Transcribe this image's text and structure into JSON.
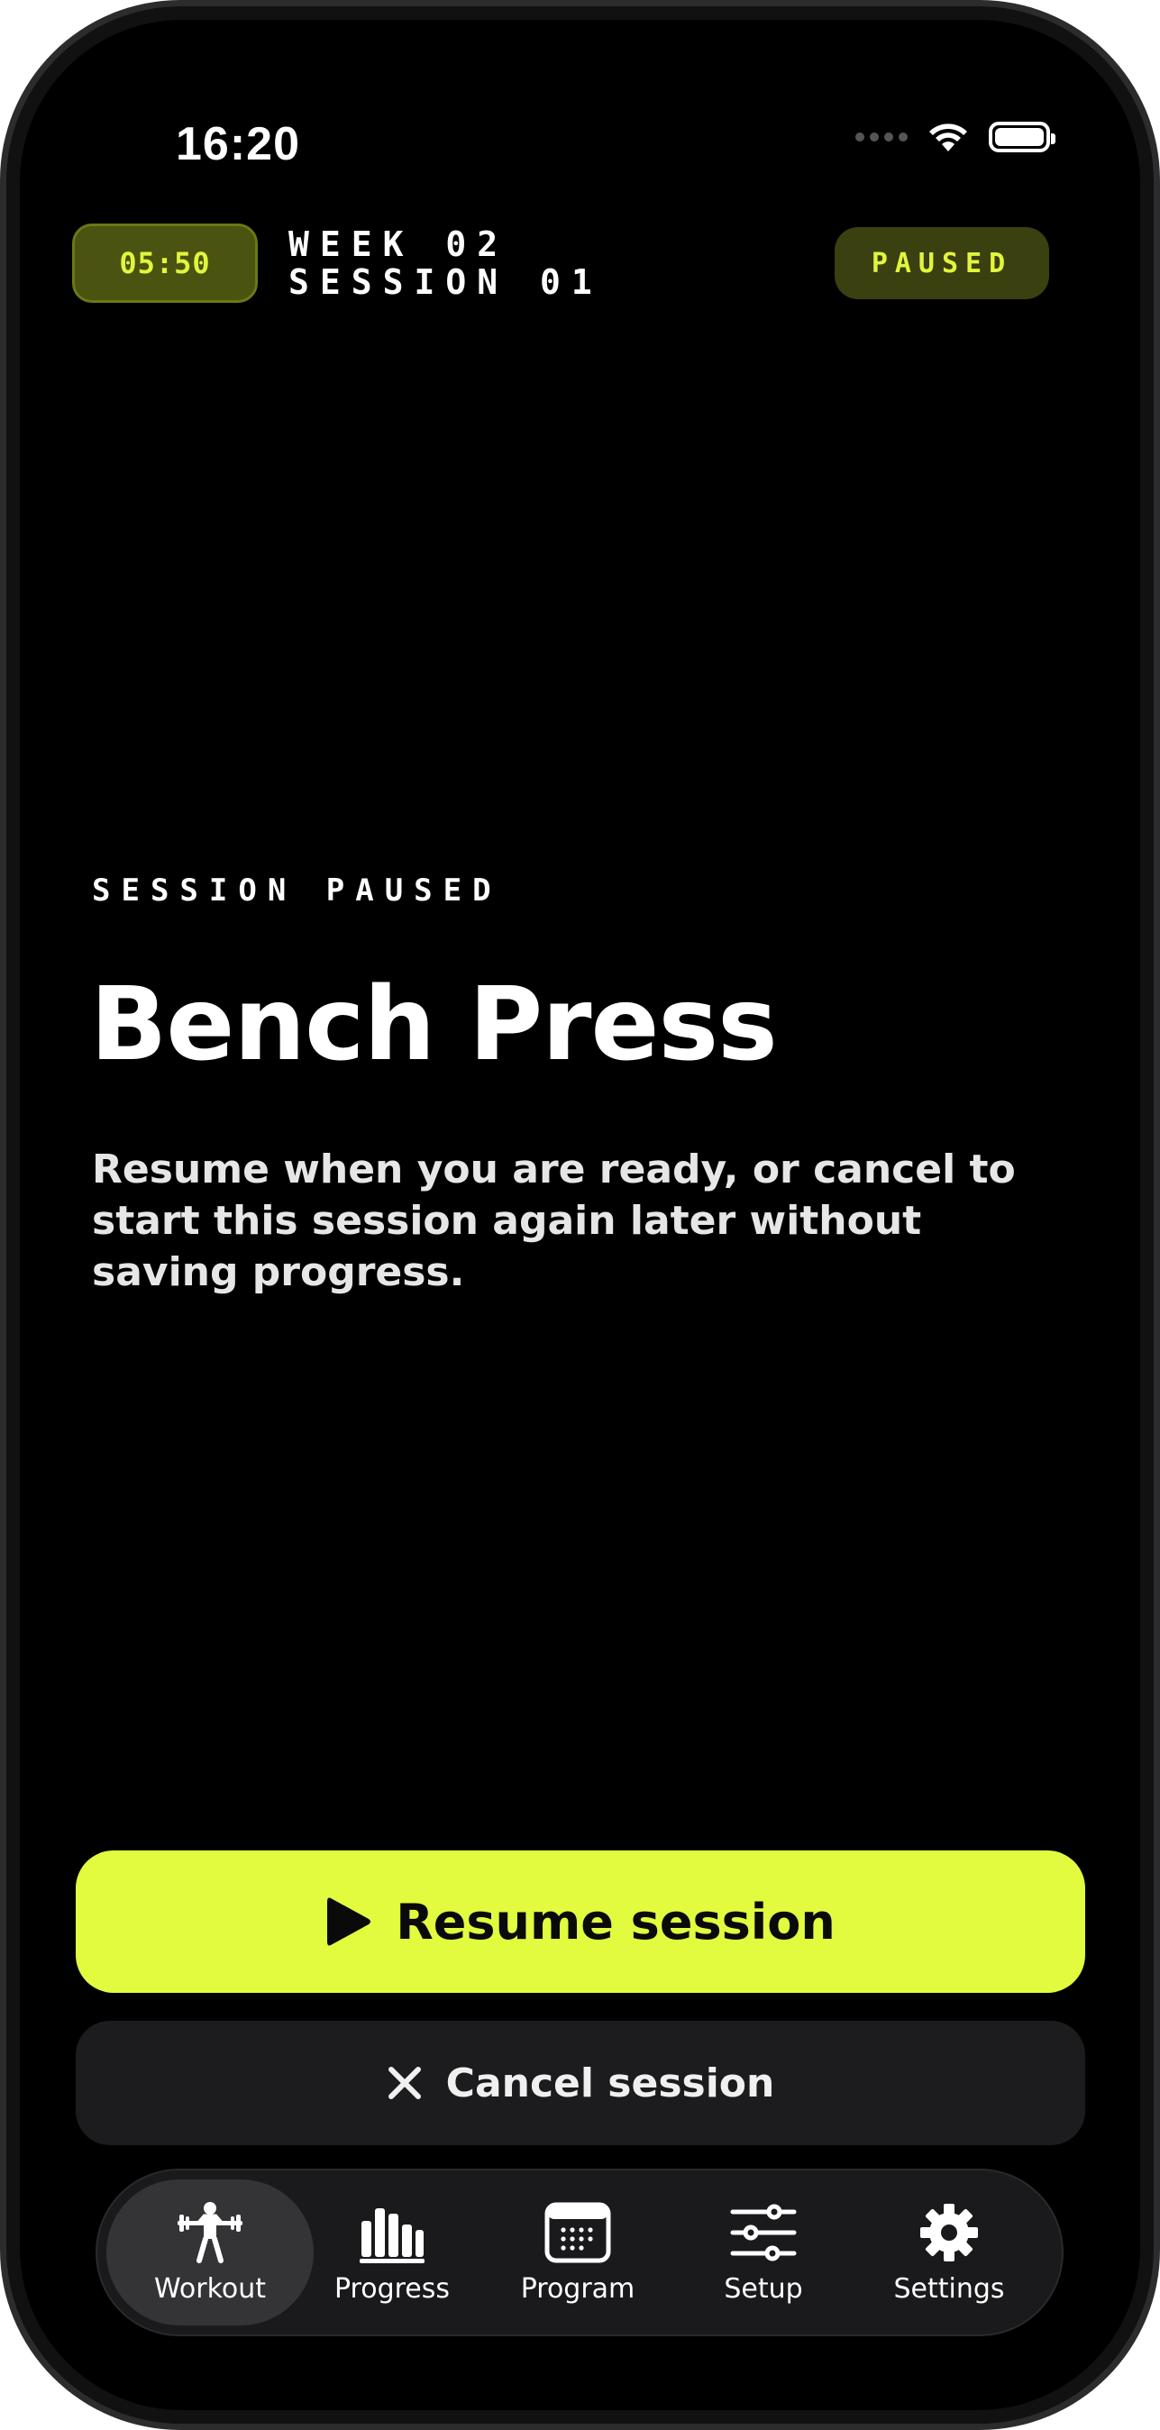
{
  "status_bar": {
    "time": "16:20"
  },
  "header": {
    "timer": "05:50",
    "week": "WEEK 02",
    "session": "SESSION 01",
    "status_badge": "PAUSED"
  },
  "main": {
    "eyebrow": "SESSION PAUSED",
    "title": "Bench Press",
    "description": "Resume when you are ready, or cancel to start this session again later without saving progress."
  },
  "actions": {
    "resume_label": "Resume session",
    "cancel_label": "Cancel session"
  },
  "tabbar": {
    "items": [
      {
        "label": "Workout",
        "icon": "weightlifter-icon",
        "active": true
      },
      {
        "label": "Progress",
        "icon": "bar-chart-icon",
        "active": false
      },
      {
        "label": "Program",
        "icon": "calendar-icon",
        "active": false
      },
      {
        "label": "Setup",
        "icon": "sliders-icon",
        "active": false
      },
      {
        "label": "Settings",
        "icon": "gear-icon",
        "active": false
      }
    ]
  },
  "colors": {
    "accent": "#e2fb3e",
    "background": "#000000",
    "secondary_button": "#1c1c1e"
  }
}
